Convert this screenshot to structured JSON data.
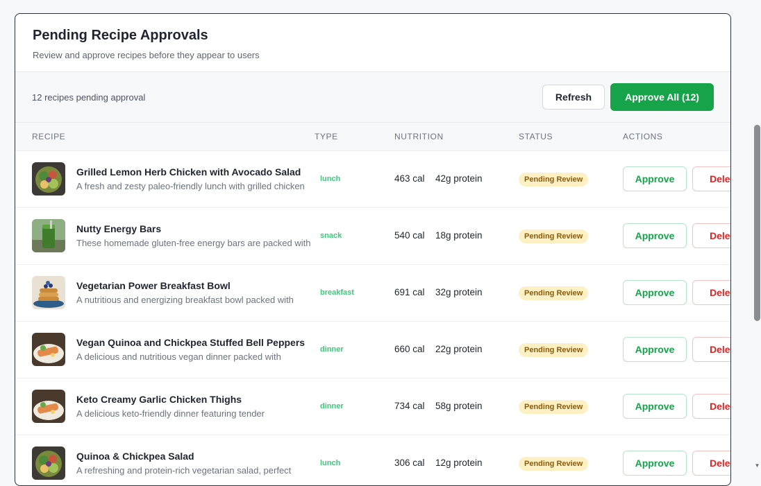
{
  "header": {
    "title": "Pending Recipe Approvals",
    "subtitle": "Review and approve recipes before they appear to users"
  },
  "toolbar": {
    "pending_count": "12 recipes pending approval",
    "refresh_label": "Refresh",
    "approve_all_label": "Approve All (12)"
  },
  "columns": {
    "recipe": "RECIPE",
    "type": "TYPE",
    "nutrition": "NUTRITION",
    "status": "STATUS",
    "actions": "ACTIONS"
  },
  "rows": [
    {
      "name": "Grilled Lemon Herb Chicken with Avocado Salad",
      "description": "A fresh and zesty paleo-friendly lunch with grilled chicken",
      "type": "lunch",
      "calories": "463 cal",
      "protein": "42g protein",
      "status": "Pending Review",
      "approve_label": "Approve",
      "delete_label": "Delete",
      "thumb_icon": "salad-bowl-thumbnail"
    },
    {
      "name": "Nutty Energy Bars",
      "description": "These homemade gluten-free energy bars are packed with",
      "type": "snack",
      "calories": "540 cal",
      "protein": "18g protein",
      "status": "Pending Review",
      "approve_label": "Approve",
      "delete_label": "Delete",
      "thumb_icon": "green-smoothie-thumbnail"
    },
    {
      "name": "Vegetarian Power Breakfast Bowl",
      "description": "A nutritious and energizing breakfast bowl packed with",
      "type": "breakfast",
      "calories": "691 cal",
      "protein": "32g protein",
      "status": "Pending Review",
      "approve_label": "Approve",
      "delete_label": "Delete",
      "thumb_icon": "pancake-stack-thumbnail"
    },
    {
      "name": "Vegan Quinoa and Chickpea Stuffed Bell Peppers",
      "description": "A delicious and nutritious vegan dinner packed with",
      "type": "dinner",
      "calories": "660 cal",
      "protein": "22g protein",
      "status": "Pending Review",
      "approve_label": "Approve",
      "delete_label": "Delete",
      "thumb_icon": "plated-dinner-thumbnail"
    },
    {
      "name": "Keto Creamy Garlic Chicken Thighs",
      "description": "A delicious keto-friendly dinner featuring tender",
      "type": "dinner",
      "calories": "734 cal",
      "protein": "58g protein",
      "status": "Pending Review",
      "approve_label": "Approve",
      "delete_label": "Delete",
      "thumb_icon": "plated-dinner-thumbnail"
    },
    {
      "name": "Quinoa & Chickpea Salad",
      "description": "A refreshing and protein-rich vegetarian salad, perfect",
      "type": "lunch",
      "calories": "306 cal",
      "protein": "12g protein",
      "status": "Pending Review",
      "approve_label": "Approve",
      "delete_label": "Delete",
      "thumb_icon": "salad-bowl-thumbnail"
    }
  ],
  "colors": {
    "accent": "#16a34a",
    "type_text": "#3cc97a",
    "badge_bg": "#fdf0c4",
    "badge_text": "#8a5b0a",
    "delete": "#dc2626"
  }
}
